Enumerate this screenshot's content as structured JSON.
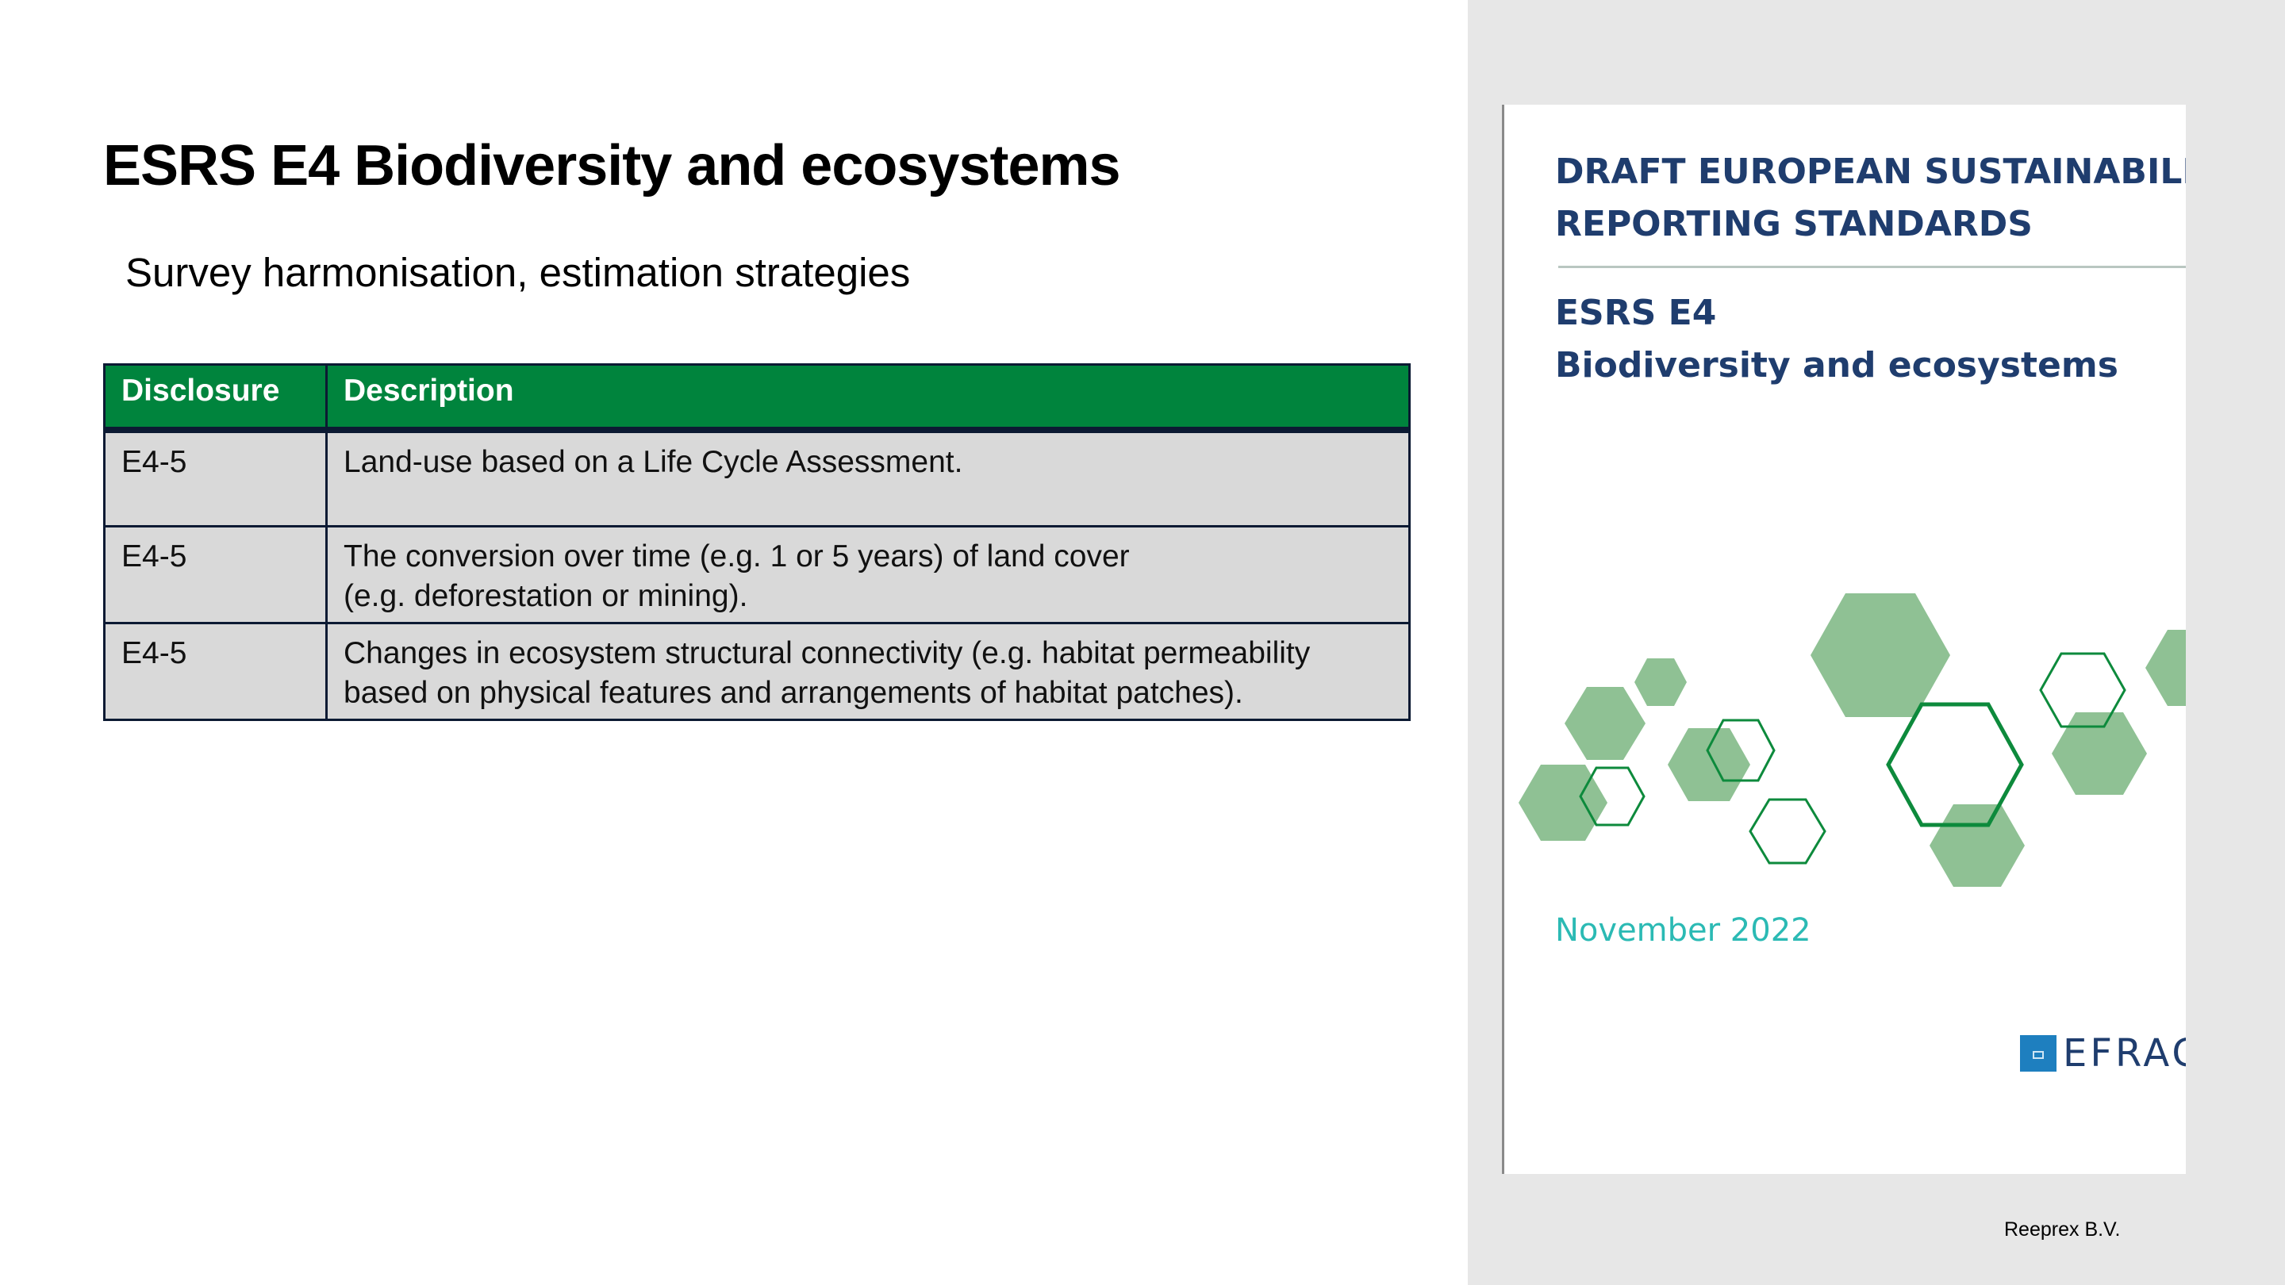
{
  "slide": {
    "title": "ESRS E4 Biodiversity and ecosystems",
    "subtitle": "Survey harmonisation, estimation strategies"
  },
  "table": {
    "headers": [
      "Disclosure",
      "Description"
    ],
    "rows": [
      {
        "disclosure": "E4-5",
        "description_lines": [
          "Land-use based on a Life Cycle Assessment."
        ]
      },
      {
        "disclosure": "E4-5",
        "description_lines": [
          "The conversion over time (e.g. 1 or 5 years) of land cover",
          "(e.g. deforestation or mining)."
        ]
      },
      {
        "disclosure": "E4-5",
        "description_lines": [
          "Changes in ecosystem structural connectivity (e.g. habitat permeability",
          "based on physical features and arrangements of habitat patches)."
        ]
      }
    ]
  },
  "cover": {
    "heading_lines": [
      "DRAFT EUROPEAN SUSTAINABILITY",
      "REPORTING STANDARDS"
    ],
    "standard_code": "ESRS E4",
    "standard_name": "Biodiversity and ecosystems",
    "date": "November 2022",
    "logo_text": "EFRAG",
    "colors": {
      "heading": "#1f3d6e",
      "date": "#2bbab4",
      "hexagon_fill": "#8fc194",
      "hexagon_stroke": "#0d8a3c"
    }
  },
  "footer": {
    "company": "Reeprex B.V."
  },
  "theme": {
    "table_header_bg": "#00843d",
    "table_cell_bg": "#d9d9d9",
    "panel_bg": "#e7e7e7"
  }
}
